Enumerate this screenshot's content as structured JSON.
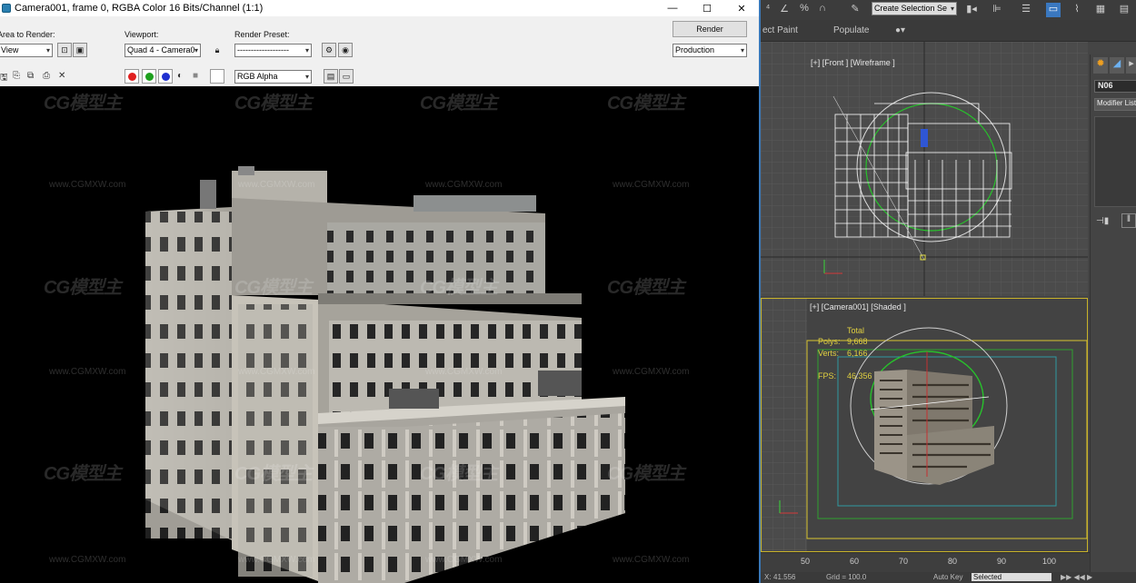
{
  "render_window": {
    "title": "Camera001, frame 0, RGBA Color 16 Bits/Channel (1:1)",
    "window_buttons": [
      "—",
      "☐",
      "✕"
    ],
    "area_to_render": {
      "label": "Area to Render:",
      "value": "View"
    },
    "viewport": {
      "label": "Viewport:",
      "value": "Quad 4 - Camera0"
    },
    "render_preset": {
      "label": "Render Preset:",
      "value": "-------------------"
    },
    "render_button": "Render",
    "production_value": "Production",
    "channel_display": "RGB Alpha"
  },
  "watermark": {
    "logo_text": "CG模型主",
    "url_text": "www.CGMXW.com"
  },
  "max_ui": {
    "ribbon_tabs": [
      "ect Paint",
      "Populate"
    ],
    "toolbar_field": "Create Selection Se",
    "front_viewport_label": "[+] [Front ] [Wireframe ]",
    "camera_viewport_label": "[+] [Camera001] [Shaded ]",
    "stats": {
      "header": "Total",
      "polys_label": "Polys:",
      "polys_value": "9,668",
      "verts_label": "Verts:",
      "verts_value": "6,166",
      "fps_label": "FPS:",
      "fps_value": "46.356"
    },
    "object_name": "N06",
    "modifier_list": "Modifier List",
    "timeline_ticks": [
      "50",
      "60",
      "70",
      "80",
      "90",
      "100"
    ],
    "status": {
      "x_value": "41.556",
      "grid_label": "Grid = 100.0",
      "autokey_label": "Auto Key",
      "selected_value": "Selected"
    }
  }
}
